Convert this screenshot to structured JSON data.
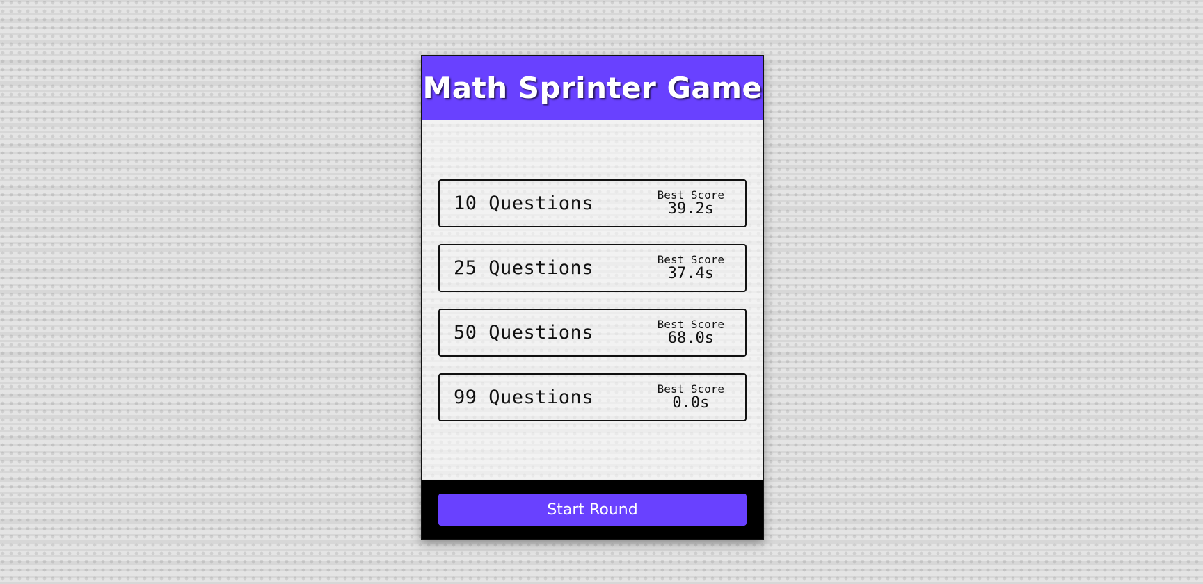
{
  "header": {
    "title": "Math Sprinter Game"
  },
  "options": [
    {
      "label": "10 Questions",
      "score_label": "Best Score",
      "score_value": "39.2s"
    },
    {
      "label": "25 Questions",
      "score_label": "Best Score",
      "score_value": "37.4s"
    },
    {
      "label": "50 Questions",
      "score_label": "Best Score",
      "score_value": "68.0s"
    },
    {
      "label": "99 Questions",
      "score_label": "Best Score",
      "score_value": "0.0s"
    }
  ],
  "footer": {
    "start_label": "Start Round"
  },
  "colors": {
    "accent": "#6941ff",
    "footer_bg": "#000000",
    "page_bg": "#e4e4e4"
  }
}
